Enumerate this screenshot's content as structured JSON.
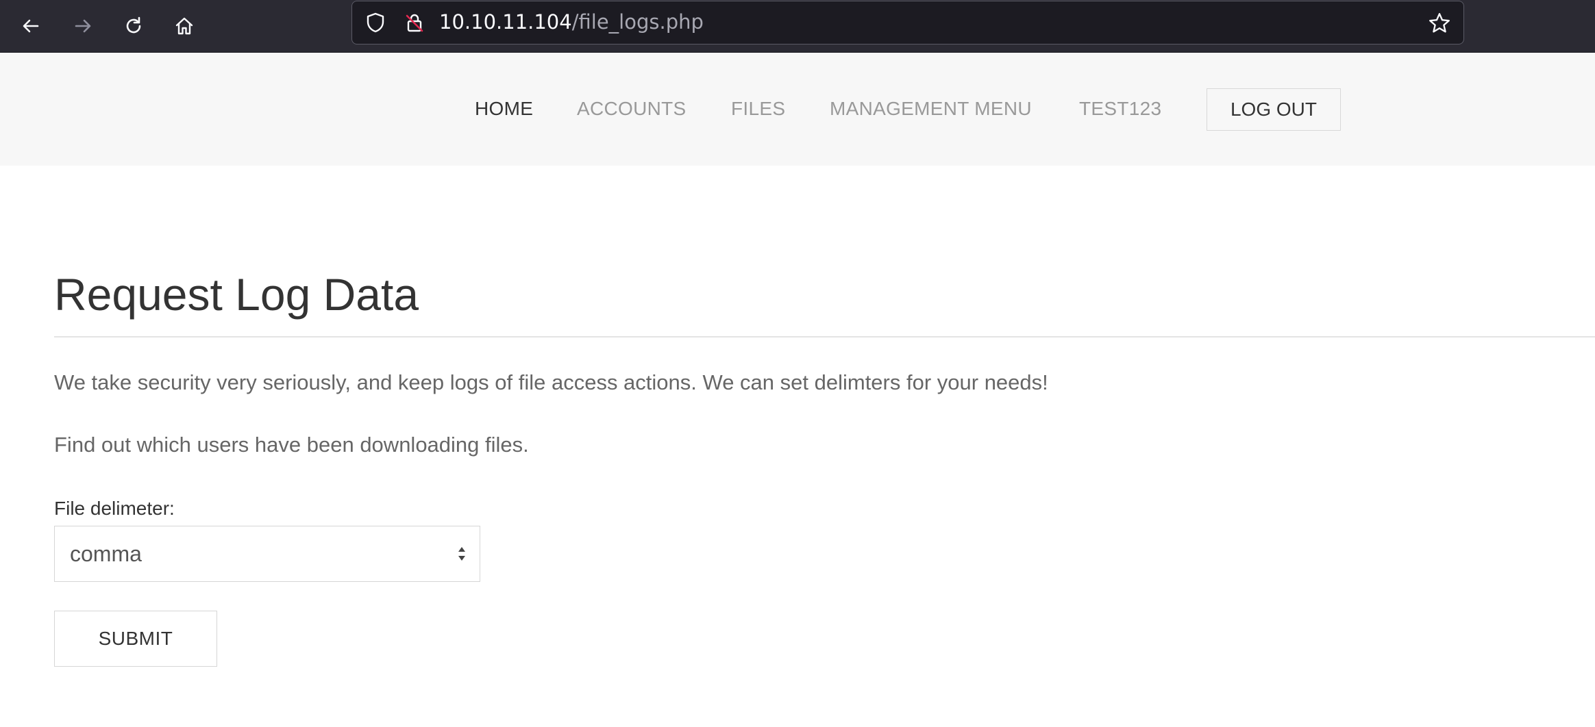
{
  "browser": {
    "url_host": "10.10.11.104",
    "url_path": "/file_logs.php"
  },
  "nav": {
    "items": [
      {
        "label": "HOME",
        "active": true
      },
      {
        "label": "ACCOUNTS",
        "active": false
      },
      {
        "label": "FILES",
        "active": false
      },
      {
        "label": "MANAGEMENT MENU",
        "active": false
      },
      {
        "label": "TEST123",
        "active": false
      }
    ],
    "logout_label": "LOG OUT"
  },
  "main": {
    "title": "Request Log Data",
    "paragraph1": "We take security very seriously, and keep logs of file access actions. We can set delimters for your needs!",
    "paragraph2": "Find out which users have been downloading files.",
    "delimiter_label": "File delimeter:",
    "delimiter_value": "comma",
    "submit_label": "SUBMIT"
  },
  "icons": {
    "back": "back-arrow-icon",
    "forward": "forward-arrow-icon",
    "reload": "reload-icon",
    "home": "home-icon",
    "shield": "shield-icon",
    "insecure_lock": "insecure-lock-icon",
    "bookmark": "star-icon"
  },
  "colors": {
    "chrome_bg": "#2b2a33",
    "header_bg": "#f7f7f7",
    "nav_active": "#333333",
    "nav_inactive": "#999999"
  }
}
